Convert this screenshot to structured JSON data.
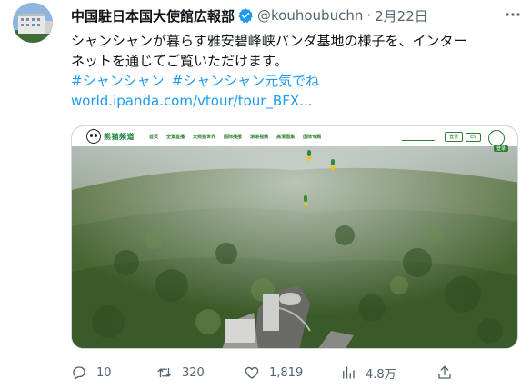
{
  "author": {
    "display_name": "中国駐日本国大使館広報部",
    "handle": "@kouhoubuchn",
    "separator": "·",
    "date": "2月22日",
    "verified": true,
    "verified_color": "#1d9bf0"
  },
  "tweet": {
    "text_line_1": "シャンシャンが暮らす雅安碧峰峡パンダ基地の様子を、インター",
    "text_line_2": "ネットを通じてご覧いただけます。",
    "hashtags": [
      "#シャンシャン",
      "#シャンシャン元気でね"
    ],
    "link": "world.ipanda.com/vtour/tour_BFX..."
  },
  "media": {
    "logo_text": "熊猫频道",
    "nav_items": [
      "首页",
      "全景直播",
      "大熊猫世界",
      "国际播报",
      "滚滚视频",
      "高清图集",
      "国际专题"
    ],
    "nav_buttons": [
      "登录",
      "EN"
    ],
    "user_label": "登录"
  },
  "actions": {
    "reply_count": "10",
    "retweet_count": "320",
    "like_count": "1,819",
    "views_count": "4.8万"
  },
  "colors": {
    "link": "#1d9bf0",
    "muted": "#536471",
    "text": "#0f1419",
    "brand_green": "#2e7d32"
  }
}
